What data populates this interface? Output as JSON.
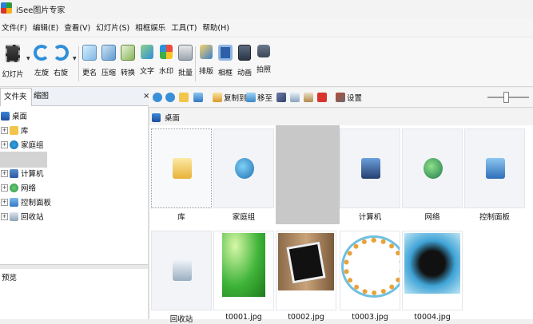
{
  "window": {
    "title": "iSee图片专家",
    "logo_icon": "app-logo-icon"
  },
  "menu": [
    "文件(F)",
    "编辑(E)",
    "查看(V)",
    "幻灯片(S)",
    "相框娱乐",
    "工具(T)",
    "帮助(H)"
  ],
  "toolbar": {
    "slideshow": "幻灯片",
    "rotate_left": "左旋",
    "rotate_right": "右旋",
    "rename": "更名",
    "compress": "压缩",
    "convert": "转换",
    "text": "文字",
    "watermark": "水印",
    "batch": "批量",
    "layout": "排版",
    "frame": "相框",
    "animation": "动画",
    "capture": "拍照"
  },
  "left_panel": {
    "tab_folder": "文件夹",
    "tab_thumbnail": "缩图",
    "close": "×",
    "tree": {
      "desktop": "桌面",
      "library": "库",
      "homegroup": "家庭组",
      "computer": "计算机",
      "network": "网络",
      "control_panel": "控制面板",
      "recycle_bin": "回收站"
    },
    "preview_label": "预览"
  },
  "right_toolbar": {
    "copy_to": "复制到",
    "move_to": "移至",
    "settings": "设置",
    "zoom_level": 0.45
  },
  "address": {
    "location": "桌面"
  },
  "items": [
    {
      "label": "库",
      "icon": "folder-icon",
      "color": "#f2c54b"
    },
    {
      "label": "家庭组",
      "icon": "homegroup-icon",
      "color": "#2e8fd6"
    },
    {
      "label": "",
      "icon": "placeholder",
      "color": "#c8c8c8"
    },
    {
      "label": "计算机",
      "icon": "computer-icon",
      "color": "#3b6fb6"
    },
    {
      "label": "网络",
      "icon": "network-icon",
      "color": "#2a8f5a"
    },
    {
      "label": "控制面板",
      "icon": "control-panel-icon",
      "color": "#3c88d0"
    },
    {
      "label": "回收站",
      "icon": "recycle-bin-icon",
      "color": "#8fa4b8"
    },
    {
      "label": "t0001.jpg",
      "icon": "image-thumbnail",
      "color": "#3fb43a"
    },
    {
      "label": "t0002.jpg",
      "icon": "image-thumbnail",
      "color": "#7a5a3a"
    },
    {
      "label": "t0003.jpg",
      "icon": "image-thumbnail",
      "color": "#f0e6c8"
    },
    {
      "label": "t0004.jpg",
      "icon": "image-thumbnail",
      "color": "#3fa3d6"
    }
  ]
}
